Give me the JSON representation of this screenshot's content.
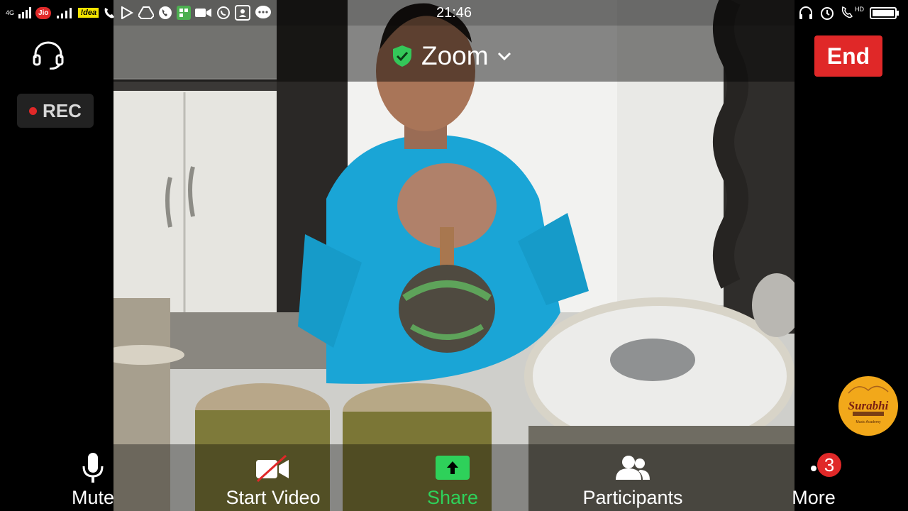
{
  "status_bar": {
    "network_type": "4G",
    "carrier_1": "Jio",
    "carrier_2": "!dea",
    "time": "21:46",
    "hd_label": "HD"
  },
  "header": {
    "meeting_title": "Zoom",
    "end_label": "End",
    "rec_label": "REC"
  },
  "toolbar": {
    "mute_label": "Mute",
    "video_label": "Start Video",
    "share_label": "Share",
    "participants_label": "Participants",
    "more_label": "More",
    "more_badge": "3"
  },
  "watermark": {
    "brand_name": "Surabhi",
    "sub_text": "Music Academy"
  },
  "colors": {
    "end_red": "#e02828",
    "share_green": "#2ed15a",
    "shield_green": "#34c759",
    "logo_orange": "#f2a81a"
  },
  "icons": [
    "headset-icon",
    "shield-check-icon",
    "chevron-down-icon",
    "microphone-icon",
    "video-off-icon",
    "share-arrow-icon",
    "participants-icon",
    "more-dots-icon"
  ]
}
